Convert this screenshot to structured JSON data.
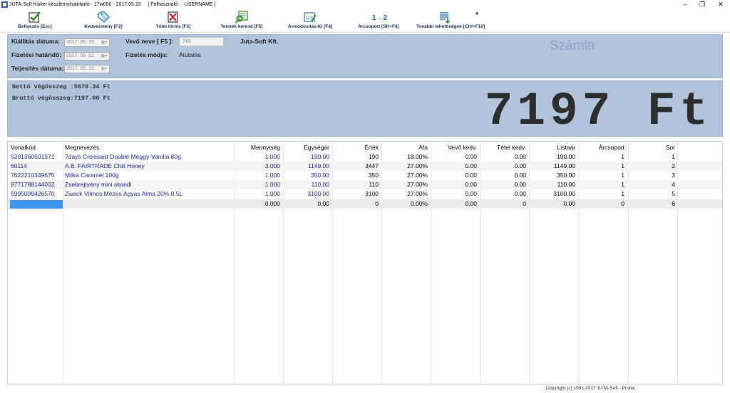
{
  "window": {
    "title": "JUTA-Soft Kisker készletnyilvántartó - 17w050 - 2017.05.15",
    "user_label": "[ Felhasználó:",
    "user_name": "USERNAME ]",
    "minimize": "–",
    "maximize": "❐",
    "close": "✕"
  },
  "toolbar": {
    "buttons": [
      {
        "label": "Befejezés [Esc]",
        "icon": "check-icon",
        "color": "#2e8b2e"
      },
      {
        "label": "Kedvezmény [F2]",
        "icon": "discount-tag-icon",
        "color": "#2a7fbf"
      },
      {
        "label": "Tétel törlés [F3]",
        "icon": "delete-cross-icon",
        "color": "#c62828"
      },
      {
        "label": "Termék kereső [F5]",
        "icon": "product-search-icon",
        "color": "#2e8b2e"
      },
      {
        "label": "Ármódosítás-Ki [F8]",
        "icon": "price-edit-icon",
        "color": "#2a7fbf"
      },
      {
        "label": "Árcsoport [SH+F6]",
        "icon": "price-group-icon",
        "color": "#1f5fbf",
        "glyph": "1→2"
      },
      {
        "label": "További lehetőségek [Ctrl+F10]",
        "icon": "more-options-icon",
        "color": "#2e8b2e"
      }
    ]
  },
  "header": {
    "kiallitas_label": "Kiállítás dátuma:",
    "kiallitas_value": "2017. 05. 19.",
    "fizetesi_label": "Fizetési határidő:",
    "fizetesi_value": "2017. 06. 02.",
    "teljesites_label": "Teljesítés dátuma:",
    "teljesites_value": "2017. 05. 19.",
    "vevo_label": "Vevő neve [ F5 ]:",
    "vevo_code": "749",
    "vevo_name": "Juta-Soft Kft.",
    "fizmod_label": "Fizetés módja:",
    "fizmod_value": "Átutalás",
    "doc_type": "Számla"
  },
  "totals": {
    "netto_line": "Nettó végösszeg :5678.34 Ft",
    "brutto_line": "Bruttó végösszeg:7197.00 Ft",
    "big_total": "7197 Ft"
  },
  "grid": {
    "columns": [
      "Vonalkód",
      "Megnevezés",
      "Mennyiség",
      "Egységár",
      "Érték",
      "Áfa",
      "Vevő kedv.",
      "Tétel kedv.",
      "Listaár",
      "Árcsoport",
      "Sor"
    ],
    "rows": [
      [
        "5201360501571",
        "7days Croissant Double Meggy-Vanília 80g",
        "1.000",
        "190.00",
        "190",
        "18.00%",
        "0.00",
        "0.00",
        "190.00",
        "1",
        "1"
      ],
      [
        "60114",
        "A.B. FAIRTRADE Chili Honey",
        "3.000",
        "1149.00",
        "3447",
        "27.00%",
        "0.00",
        "0.00",
        "1149.00",
        "1",
        "2"
      ],
      [
        "7622210349675",
        "Milka Caramel 100g",
        "1.000",
        "350.00",
        "350",
        "27.00%",
        "0.00",
        "0.00",
        "350.00",
        "1",
        "3"
      ],
      [
        "9771788144002",
        "Zsebrejtvény mini skandi",
        "1.000",
        "110.00",
        "110",
        "27.00%",
        "0.00",
        "0.00",
        "110.00",
        "1",
        "4"
      ],
      [
        "5995099426570",
        "Zwack Vilmos Mézes Ágyas Alma 20% 0,5L",
        "1.000",
        "3100.00",
        "3100",
        "27.00%",
        "0.00",
        "0.00",
        "3100.00",
        "1",
        "5"
      ]
    ],
    "new_row": [
      "",
      "",
      "0.000",
      "0.00",
      "0",
      "0.00%",
      "0.00",
      "0",
      "0.00",
      "0",
      "6"
    ]
  },
  "status": {
    "copyright": "Copyright (c) 1991-2017 JUTA-Soft  -  Proba"
  }
}
